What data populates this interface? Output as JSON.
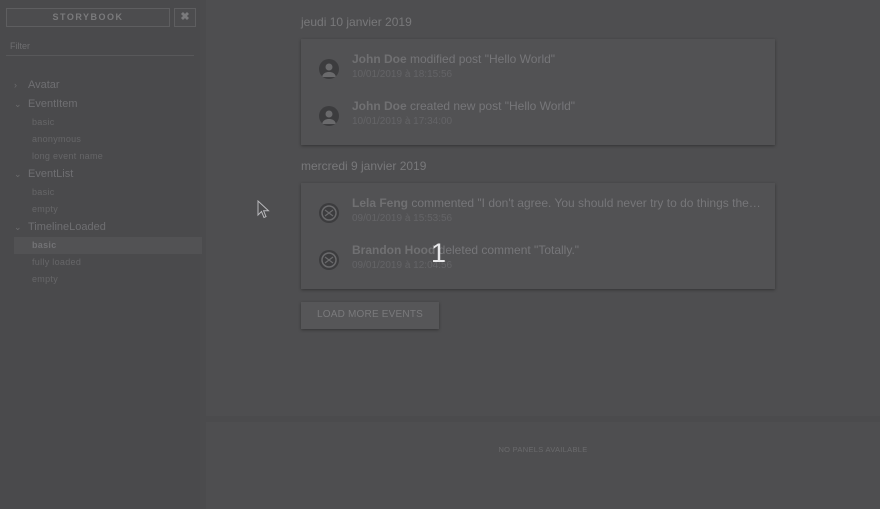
{
  "sidebar": {
    "brand": "STORYBOOK",
    "close_glyph": "✖",
    "filter_placeholder": "Filter",
    "tree": [
      {
        "label": "Avatar",
        "chevron": "›",
        "children": []
      },
      {
        "label": "EventItem",
        "chevron": "⌄",
        "children": [
          "basic",
          "anonymous",
          "long event name"
        ]
      },
      {
        "label": "EventList",
        "chevron": "⌄",
        "children": [
          "basic",
          "empty"
        ]
      },
      {
        "label": "TimelineLoaded",
        "chevron": "⌄",
        "children": [
          "basic",
          "fully loaded",
          "empty"
        ]
      }
    ],
    "selected": "TimelineLoaded/basic"
  },
  "timeline": {
    "groups": [
      {
        "date": "jeudi 10 janvier 2019",
        "events": [
          {
            "author": "John Doe",
            "text": "modified post \"Hello World\"",
            "timestamp": "10/01/2019 à 18:15:56"
          },
          {
            "author": "John Doe",
            "text": "created new post \"Hello World\"",
            "timestamp": "10/01/2019 à 17:34:00"
          }
        ]
      },
      {
        "date": "mercredi 9 janvier 2019",
        "events": [
          {
            "author": "Lela Feng",
            "text": "commented \"I don't agree. You should never try to do things the way they are done in other frameworks.\"",
            "timestamp": "09/01/2019 à 15:53:56"
          },
          {
            "author": "Brandon Hood",
            "text": "deleted comment \"Totally.\"",
            "timestamp": "09/01/2019 à 12:04:56"
          }
        ]
      }
    ],
    "load_more_label": "LOAD MORE EVENTS"
  },
  "panels": {
    "empty_text": "NO PANELS AVAILABLE"
  },
  "overlay": {
    "step_number": "1",
    "cursor_icon": "pointer-cursor-icon"
  },
  "colors": {
    "overlay_dim": "#4b4b4d",
    "card": "#525254"
  }
}
